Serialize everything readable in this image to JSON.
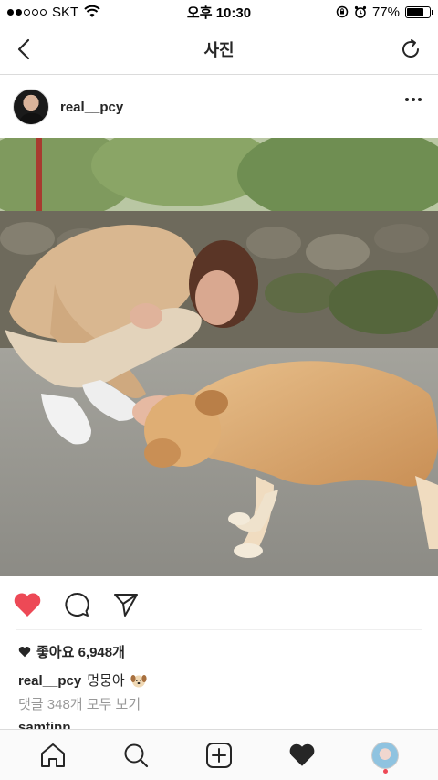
{
  "status_bar": {
    "carrier": "SKT",
    "time": "오후 10:30",
    "battery": "77%",
    "battery_level": 0.77,
    "signal_dots_filled": 2,
    "signal_dots_total": 5
  },
  "nav": {
    "title": "사진"
  },
  "post": {
    "username": "real__pcy",
    "likes_text": "좋아요 6,948개",
    "caption_user": "real__pcy",
    "caption_text": "멍뭉아",
    "caption_emoji": "dog-face-icon",
    "view_comments": "댓글 348개 모두 보기",
    "next_comment_user": "samtinn"
  },
  "icons": {
    "back": "chevron-left-icon",
    "refresh": "refresh-icon",
    "more": "more-horizontal-icon",
    "like": "heart-icon",
    "comment": "comment-icon",
    "share": "paper-plane-icon",
    "tab_home": "home-icon",
    "tab_search": "search-icon",
    "tab_add": "add-square-icon",
    "tab_activity": "heart-icon",
    "tab_profile": "avatar"
  },
  "colors": {
    "liked": "#ed4956",
    "text": "#262626",
    "secondary_text": "#999999",
    "divider": "#dbdbdb",
    "notification_dot": "#ed4956"
  }
}
